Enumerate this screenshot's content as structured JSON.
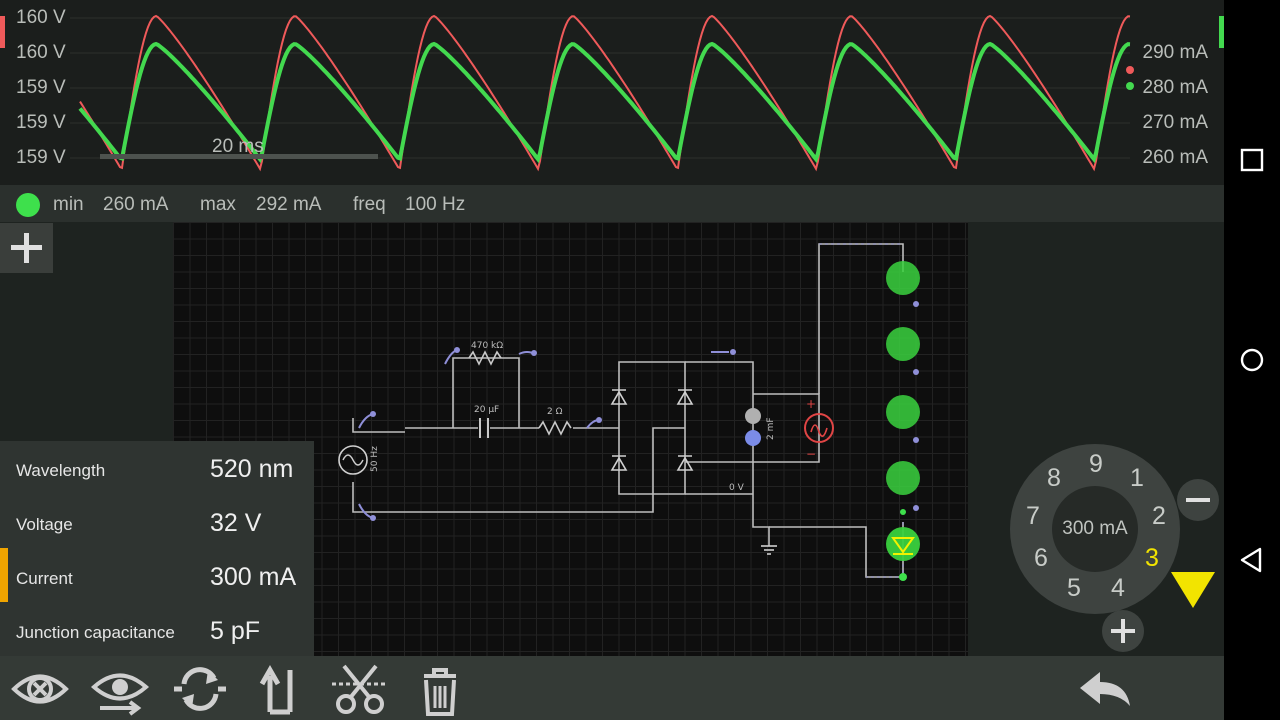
{
  "scope": {
    "left_axis": [
      "160 V",
      "160 V",
      "159 V",
      "159 V",
      "159 V"
    ],
    "right_axis": [
      "290 mA",
      "280 mA",
      "270 mA",
      "260 mA"
    ],
    "timescale": "20 ms",
    "series_colors": {
      "voltage": "#ef5a5a",
      "current": "#43d94f"
    }
  },
  "stats": {
    "min_label": "min",
    "min_value": "260 mA",
    "max_label": "max",
    "max_value": "292 mA",
    "freq_label": "freq",
    "freq_value": "100 Hz"
  },
  "circuit": {
    "resistor1": "470 kΩ",
    "capacitor1": "20 µF",
    "resistor2": "2 Ω",
    "source_freq": "50 Hz",
    "capacitor2": "2 mF",
    "ground_label": "0 V",
    "plus": "+",
    "minus": "−"
  },
  "properties": [
    {
      "label": "Wavelength",
      "value": "520 nm"
    },
    {
      "label": "Voltage",
      "value": "32 V"
    },
    {
      "label": "Current",
      "value": "300 mA"
    },
    {
      "label": "Junction capacitance",
      "value": "5 pF"
    }
  ],
  "dial": {
    "value": "300 mA",
    "numbers": [
      "9",
      "1",
      "2",
      "3",
      "4",
      "5",
      "6",
      "7",
      "8"
    ],
    "selected": "3",
    "selected_color": "#f2e400"
  },
  "toolbar": {
    "icons": [
      "hide-icon",
      "eye-arrow-icon",
      "rotate-icon",
      "flip-icon",
      "cut-icon",
      "delete-icon",
      "undo-icon"
    ]
  },
  "navbar": {
    "icons": [
      "recents-icon",
      "home-icon",
      "back-icon"
    ]
  }
}
